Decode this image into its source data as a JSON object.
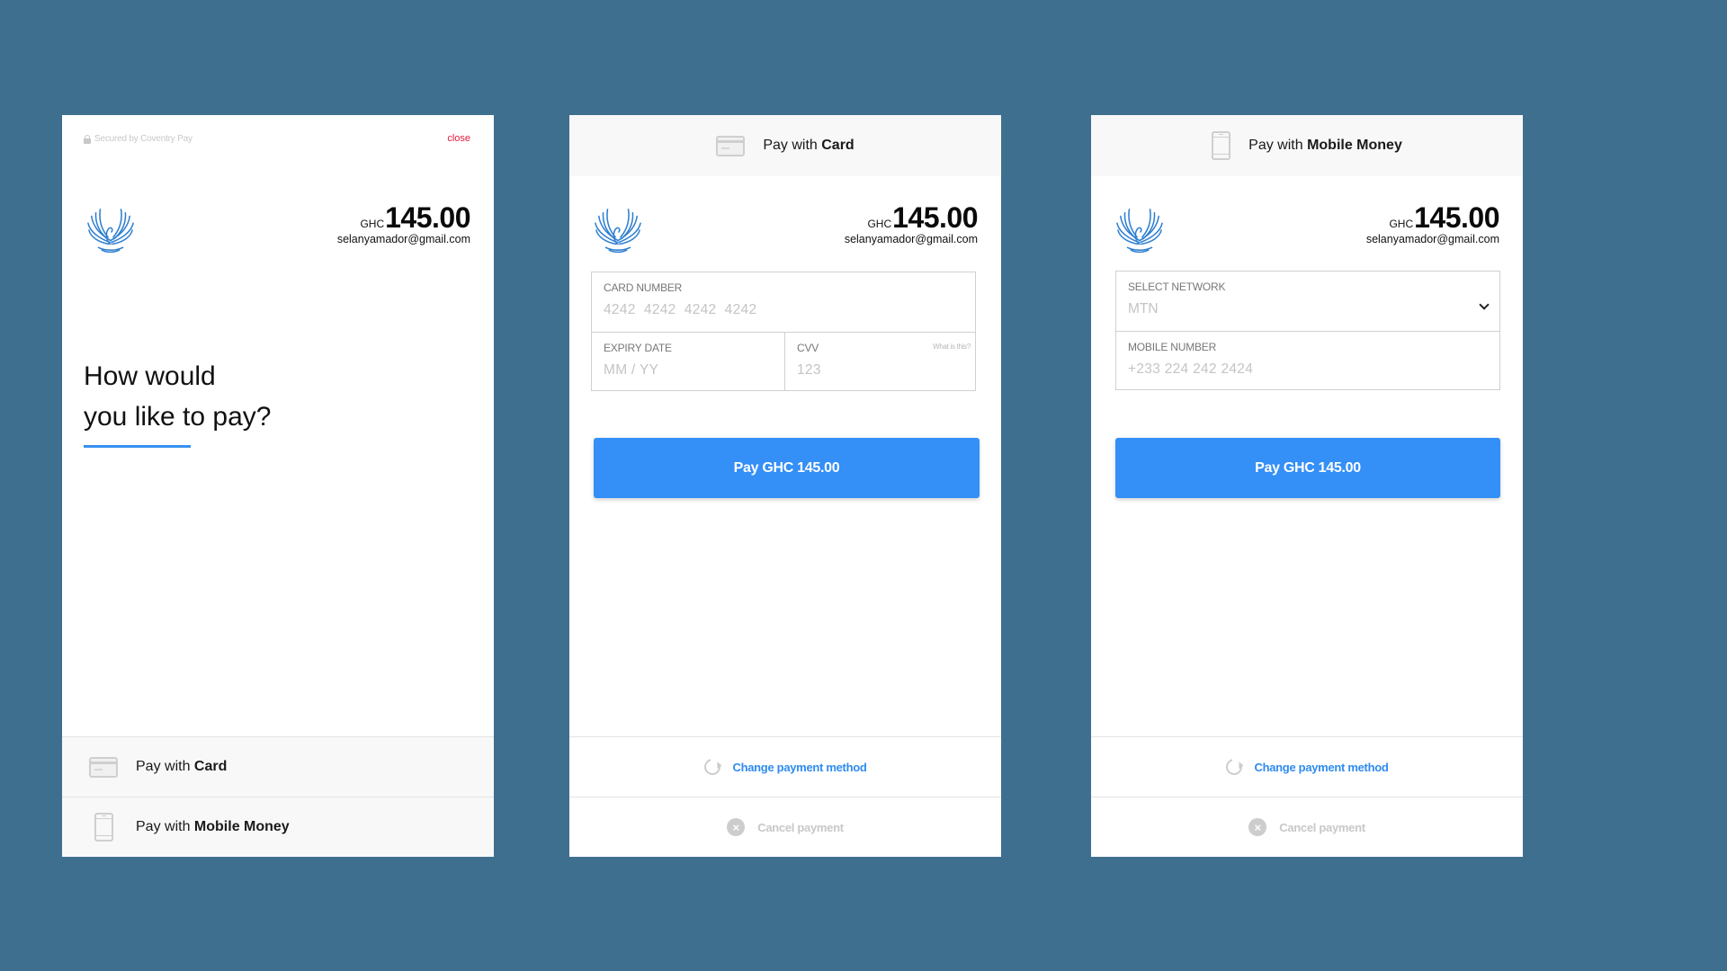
{
  "colors": {
    "background": "#3f6f8f",
    "accent": "#348ff6",
    "close": "#e5183d",
    "link": "#2f8bf0"
  },
  "merchant": {
    "currency": "GHC",
    "amount": "145.00",
    "email": "selanyamador@gmail.com",
    "logo_icon": "phoenix-logo"
  },
  "select_panel": {
    "secured_text": "Secured by Coventry Pay",
    "close_label": "close",
    "question_line1": "How would",
    "question_line2": "you like to pay?",
    "options": [
      {
        "prefix": "Pay with ",
        "method": "Card",
        "icon": "credit-card-icon"
      },
      {
        "prefix": "Pay with ",
        "method": "Mobile Money",
        "icon": "mobile-phone-icon"
      }
    ]
  },
  "card_panel": {
    "header_prefix": "Pay with ",
    "header_method": "Card",
    "card_number_label": "CARD NUMBER",
    "card_number_placeholder": "4242  4242  4242  4242",
    "card_number_value": "",
    "expiry_label": "EXPIRY DATE",
    "expiry_placeholder": "MM / YY",
    "expiry_value": "",
    "cvv_label": "CVV",
    "cvv_placeholder": "123",
    "cvv_value": "",
    "cvv_help": "What is this?",
    "pay_button": "Pay GHC 145.00",
    "change_method": "Change payment method",
    "cancel": "Cancel payment"
  },
  "momo_panel": {
    "header_prefix": "Pay with ",
    "header_method": "Mobile Money",
    "network_label": "SELECT NETWORK",
    "network_selected": "MTN",
    "mobile_label": "MOBILE NUMBER",
    "mobile_placeholder": "+233 224 242 2424",
    "mobile_value": "",
    "pay_button": "Pay GHC 145.00",
    "change_method": "Change payment method",
    "cancel": "Cancel payment"
  }
}
